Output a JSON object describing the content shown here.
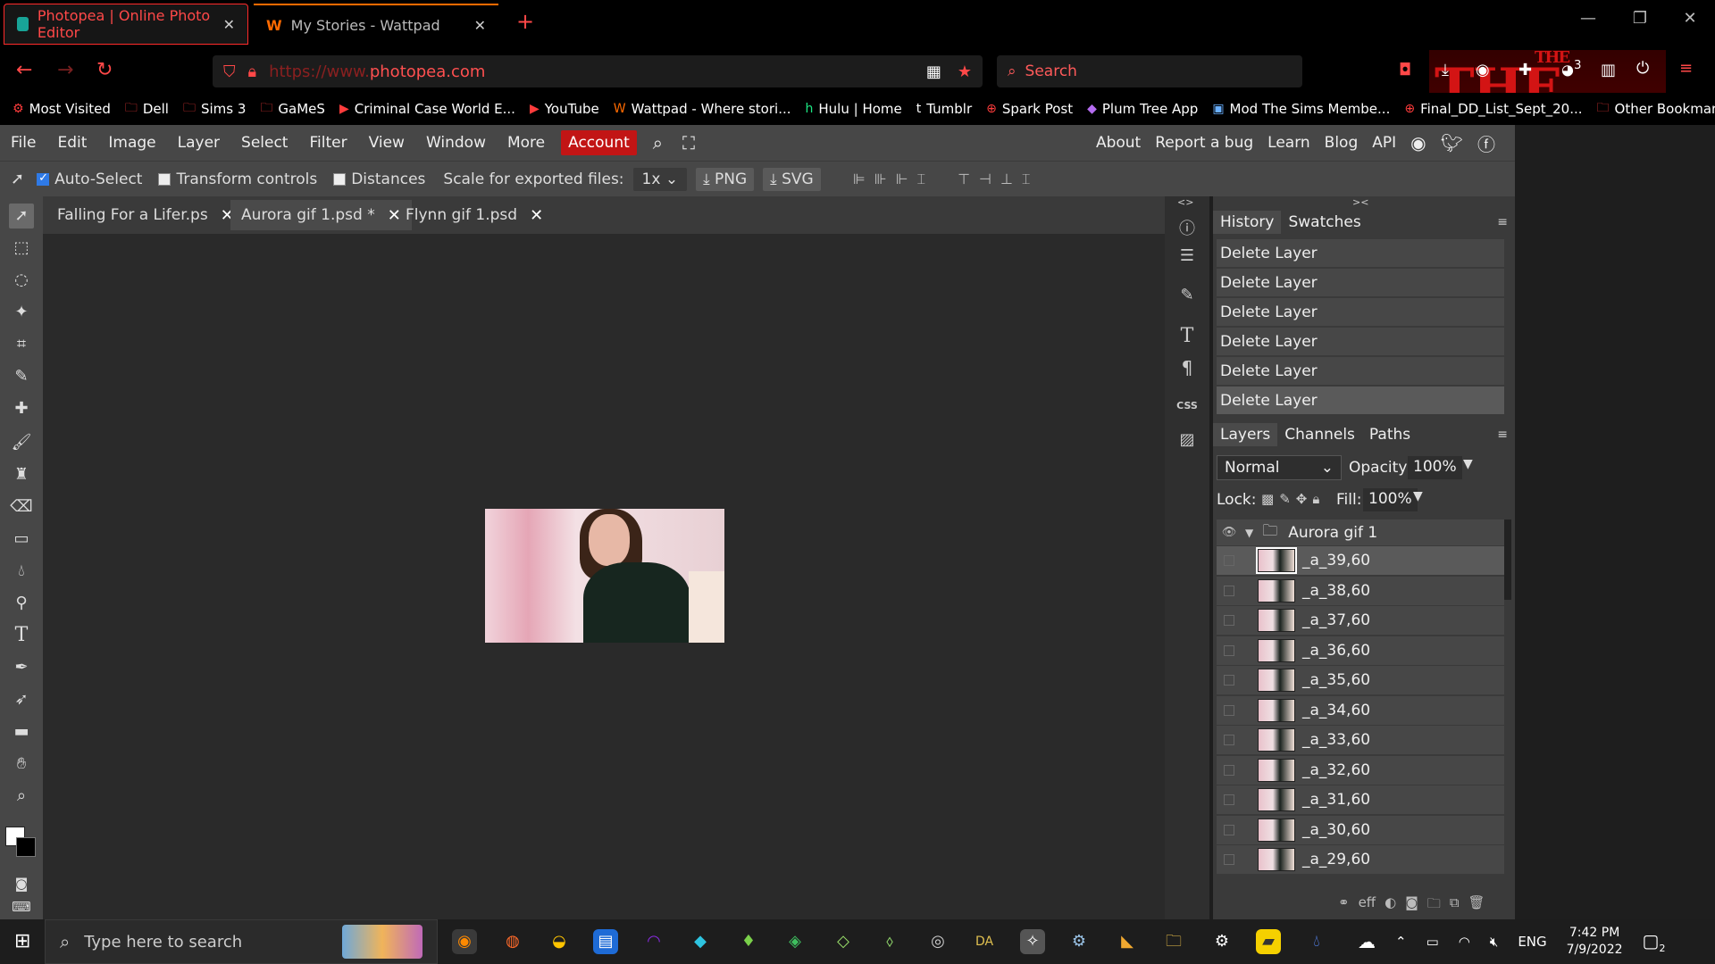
{
  "browser": {
    "tabs": [
      {
        "title": "Photopea | Online Photo Editor",
        "active": true
      },
      {
        "title": "My Stories - Wattpad",
        "active": false
      }
    ],
    "new_tab": "+",
    "url_prefix": "https://www.",
    "url_host": "photopea.com",
    "search_placeholder": "Search",
    "window_controls": {
      "minimize": "—",
      "restore": "❐",
      "close": "✕"
    },
    "theme_text": "THE BATMAN",
    "theme_small": "THE",
    "ext_badge": "3",
    "bookmarks": [
      {
        "label": "Most Visited",
        "icon": "gear-icon"
      },
      {
        "label": "Dell",
        "icon": "folder-icon"
      },
      {
        "label": "Sims 3",
        "icon": "folder-icon"
      },
      {
        "label": "GaMeS",
        "icon": "folder-icon"
      },
      {
        "label": "Criminal Case World E...",
        "icon": "youtube-icon"
      },
      {
        "label": "YouTube",
        "icon": "youtube-icon"
      },
      {
        "label": "Wattpad - Where stori...",
        "icon": "wattpad-icon"
      },
      {
        "label": "Hulu | Home",
        "icon": "hulu-icon"
      },
      {
        "label": "Tumblr",
        "icon": "tumblr-icon"
      },
      {
        "label": "Spark Post",
        "icon": "globe-icon"
      },
      {
        "label": "Plum Tree App",
        "icon": "gem-icon"
      },
      {
        "label": "Mod The Sims Membe...",
        "icon": "image-icon"
      },
      {
        "label": "Final_DD_List_Sept_20...",
        "icon": "globe-icon"
      }
    ],
    "other_bookmarks": "Other Bookmarks"
  },
  "menubar": {
    "items": [
      "File",
      "Edit",
      "Image",
      "Layer",
      "Select",
      "Filter",
      "View",
      "Window",
      "More"
    ],
    "account": "Account",
    "right": [
      "About",
      "Report a bug",
      "Learn",
      "Blog",
      "API"
    ]
  },
  "options": {
    "auto_select": "Auto-Select",
    "transform_controls": "Transform controls",
    "distances": "Distances",
    "scale_label": "Scale for exported files:",
    "scale_value": "1x",
    "png": "PNG",
    "svg": "SVG"
  },
  "documents": [
    {
      "name": "Falling For a Lifer.ps",
      "active": false
    },
    {
      "name": "Aurora gif 1.psd *",
      "active": true
    },
    {
      "name": "Flynn gif 1.psd",
      "active": false
    }
  ],
  "history": {
    "tabs": [
      "History",
      "Swatches"
    ],
    "items": [
      "Delete Layer",
      "Delete Layer",
      "Delete Layer",
      "Delete Layer",
      "Delete Layer",
      "Delete Layer"
    ]
  },
  "layers": {
    "tabs": [
      "Layers",
      "Channels",
      "Paths"
    ],
    "blend_mode": "Normal",
    "opacity_label": "Opacity:",
    "opacity": "100%",
    "lock_label": "Lock:",
    "fill_label": "Fill:",
    "fill": "100%",
    "group": "Aurora gif 1",
    "items": [
      "_a_39,60",
      "_a_38,60",
      "_a_37,60",
      "_a_36,60",
      "_a_35,60",
      "_a_34,60",
      "_a_33,60",
      "_a_32,60",
      "_a_31,60",
      "_a_30,60",
      "_a_29,60"
    ]
  },
  "panel_toggles": {
    "left": "<>",
    "right": "><"
  },
  "taskbar": {
    "search_placeholder": "Type here to search",
    "language": "ENG",
    "time": "7:42 PM",
    "date": "7/9/2022",
    "notification_count": "2"
  }
}
